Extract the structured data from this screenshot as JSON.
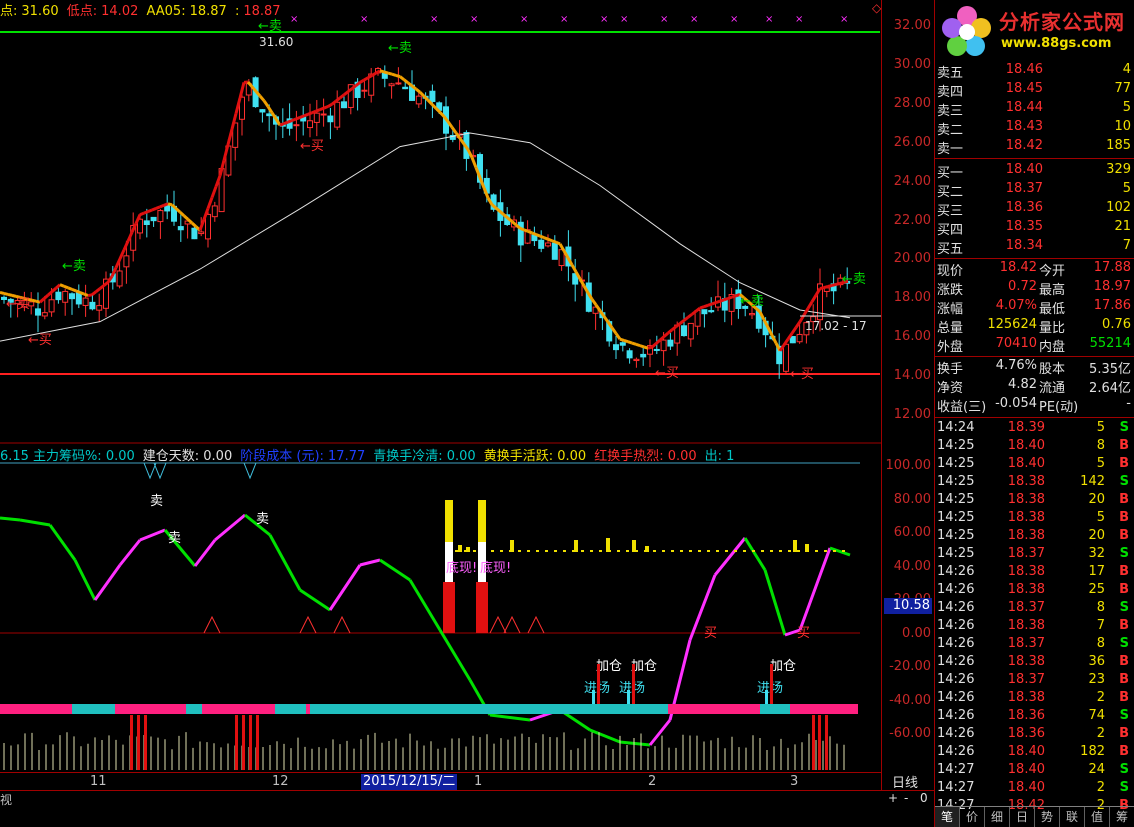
{
  "header": {
    "high_label": "点:",
    "high_value": "31.60",
    "low_label": "低点:",
    "low_value": "14.02",
    "aa_label": "AA05:",
    "aa_value1": "18.87",
    "aa_value2": "18.87"
  },
  "main_chart": {
    "y_ticks": [
      "32.00",
      "30.00",
      "28.00",
      "26.00",
      "24.00",
      "22.00",
      "20.00",
      "18.00",
      "16.00",
      "14.00",
      "12.00"
    ],
    "peak_label": "31.60",
    "current_label": "17.02 - 17",
    "sell": "卖",
    "buy": "买"
  },
  "indicator": {
    "items": [
      {
        "label": "6.15",
        "color": "#00c8c8"
      },
      {
        "label": "主力筹码%: 0.00",
        "color": "#00c8c8"
      },
      {
        "label": "建仓天数: 0.00",
        "color": "#e0e0e0"
      },
      {
        "label": "阶段成本 (元): 17.77",
        "color": "#2040ff"
      },
      {
        "label": "青换手冷清: 0.00",
        "color": "#00c8c8"
      },
      {
        "label": "黄换手活跃: 0.00",
        "color": "#f0e000"
      },
      {
        "label": "红换手热烈: 0.00",
        "color": "#ff3030"
      },
      {
        "label": "出: 1",
        "color": "#00c8c8"
      }
    ],
    "y_ticks": [
      "100.00",
      "80.00",
      "60.00",
      "40.00",
      "20.00",
      "0.00",
      "-20.00",
      "-40.00",
      "-60.00"
    ],
    "value_box": "10.58",
    "label_sell": "卖",
    "label_appear": "底现!",
    "label_buy": "买",
    "label_add": "加仓",
    "label_enter": "进场"
  },
  "date_axis": {
    "labels": [
      "11",
      "12",
      "1",
      "2",
      "3"
    ],
    "cursor_date": "2015/12/15/二",
    "period": "日线",
    "left_stub": "视",
    "zoom_plus": "+",
    "zoom_minus": "-",
    "zoom_zero": "0"
  },
  "panel": {
    "logo_title": "分析家公式网",
    "logo_url": "www.88gs.com",
    "sell_orders": [
      {
        "label": "卖五",
        "price": "18.46",
        "vol": "4"
      },
      {
        "label": "卖四",
        "price": "18.45",
        "vol": "77"
      },
      {
        "label": "卖三",
        "price": "18.44",
        "vol": "5"
      },
      {
        "label": "卖二",
        "price": "18.43",
        "vol": "10"
      },
      {
        "label": "卖一",
        "price": "18.42",
        "vol": "185"
      }
    ],
    "buy_orders": [
      {
        "label": "买一",
        "price": "18.40",
        "vol": "329"
      },
      {
        "label": "买二",
        "price": "18.37",
        "vol": "5"
      },
      {
        "label": "买三",
        "price": "18.36",
        "vol": "102"
      },
      {
        "label": "买四",
        "price": "18.35",
        "vol": "21"
      },
      {
        "label": "买五",
        "price": "18.34",
        "vol": "7"
      }
    ],
    "quote": [
      {
        "l1": "现价",
        "v1": "18.42",
        "c1": "#ff3030",
        "l2": "今开",
        "v2": "17.88",
        "c2": "#ff3030"
      },
      {
        "l1": "涨跌",
        "v1": "0.72",
        "c1": "#ff3030",
        "l2": "最高",
        "v2": "18.97",
        "c2": "#ff3030"
      },
      {
        "l1": "涨幅",
        "v1": "4.07%",
        "c1": "#ff3030",
        "l2": "最低",
        "v2": "17.86",
        "c2": "#ff3030"
      },
      {
        "l1": "总量",
        "v1": "125624",
        "c1": "#f0e000",
        "l2": "量比",
        "v2": "0.76",
        "c2": "#f0e000"
      },
      {
        "l1": "外盘",
        "v1": "70410",
        "c1": "#ff3030",
        "l2": "内盘",
        "v2": "55214",
        "c2": "#00e000"
      }
    ],
    "quote2": [
      {
        "l1": "换手",
        "v1": "4.76%",
        "c1": "#e0e0e0",
        "l2": "股本",
        "v2": "5.35亿",
        "c2": "#e0e0e0"
      },
      {
        "l1": "净资",
        "v1": "4.82",
        "c1": "#e0e0e0",
        "l2": "流通",
        "v2": "2.64亿",
        "c2": "#e0e0e0"
      },
      {
        "l1": "收益(三)",
        "v1": "-0.054",
        "c1": "#e0e0e0",
        "l2": "PE(动)",
        "v2": "-",
        "c2": "#e0e0e0"
      }
    ],
    "ticks": [
      {
        "t": "14:24",
        "p": "18.39",
        "v": "5",
        "bs": "S"
      },
      {
        "t": "14:25",
        "p": "18.40",
        "v": "8",
        "bs": "B"
      },
      {
        "t": "14:25",
        "p": "18.40",
        "v": "5",
        "bs": "B"
      },
      {
        "t": "14:25",
        "p": "18.38",
        "v": "142",
        "bs": "S"
      },
      {
        "t": "14:25",
        "p": "18.38",
        "v": "20",
        "bs": "B"
      },
      {
        "t": "14:25",
        "p": "18.38",
        "v": "5",
        "bs": "B"
      },
      {
        "t": "14:25",
        "p": "18.38",
        "v": "20",
        "bs": "B"
      },
      {
        "t": "14:25",
        "p": "18.37",
        "v": "32",
        "bs": "S"
      },
      {
        "t": "14:26",
        "p": "18.38",
        "v": "17",
        "bs": "B"
      },
      {
        "t": "14:26",
        "p": "18.38",
        "v": "25",
        "bs": "B"
      },
      {
        "t": "14:26",
        "p": "18.37",
        "v": "8",
        "bs": "S"
      },
      {
        "t": "14:26",
        "p": "18.38",
        "v": "7",
        "bs": "B"
      },
      {
        "t": "14:26",
        "p": "18.37",
        "v": "8",
        "bs": "S"
      },
      {
        "t": "14:26",
        "p": "18.38",
        "v": "36",
        "bs": "B"
      },
      {
        "t": "14:26",
        "p": "18.37",
        "v": "23",
        "bs": "B"
      },
      {
        "t": "14:26",
        "p": "18.38",
        "v": "2",
        "bs": "B"
      },
      {
        "t": "14:26",
        "p": "18.36",
        "v": "74",
        "bs": "S"
      },
      {
        "t": "14:26",
        "p": "18.36",
        "v": "2",
        "bs": "B"
      },
      {
        "t": "14:26",
        "p": "18.40",
        "v": "182",
        "bs": "B"
      },
      {
        "t": "14:27",
        "p": "18.40",
        "v": "24",
        "bs": "S"
      },
      {
        "t": "14:27",
        "p": "18.40",
        "v": "2",
        "bs": "S"
      },
      {
        "t": "14:27",
        "p": "18.42",
        "v": "2",
        "bs": "B"
      }
    ],
    "tabs": [
      "笔",
      "价",
      "细",
      "日",
      "势",
      "联",
      "值",
      "筹"
    ]
  },
  "colors": {
    "up": "#ff3030",
    "down": "#40e0f0",
    "ma_red": "#e01010",
    "ma_orange": "#f0a000",
    "ma_white": "#e0e0e0",
    "green": "#00e000",
    "magenta": "#ff30ff",
    "axis": "#a00000",
    "yellow": "#f0e000"
  }
}
